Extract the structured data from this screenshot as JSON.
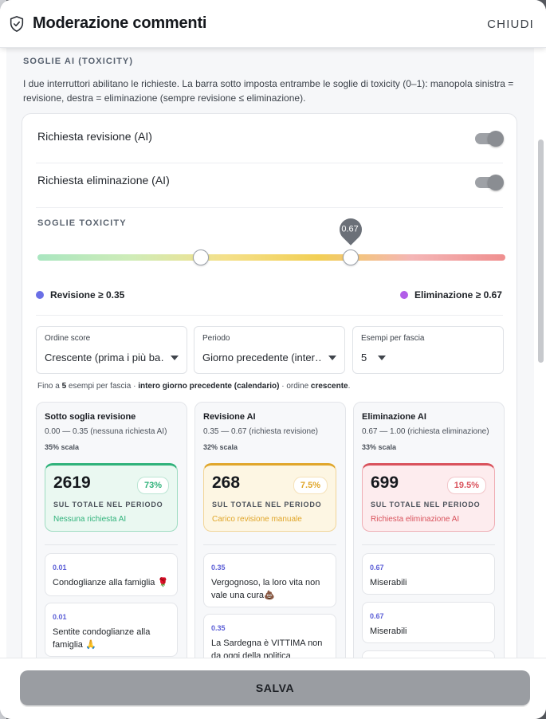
{
  "header": {
    "title": "Moderazione commenti",
    "close_label": "CHIUDI"
  },
  "section": {
    "title": "SOGLIE AI (TOXICITY)",
    "description": "I due interruttori abilitano le richieste. La barra sotto imposta entrambe le soglie di toxicity (0–1): manopola sinistra = revisione, destra = eliminazione (sempre revisione ≤ eliminazione)."
  },
  "toggles": [
    {
      "label": "Richiesta revisione (AI)",
      "on": true
    },
    {
      "label": "Richiesta eliminazione (AI)",
      "on": true
    }
  ],
  "slider": {
    "title": "SOGLIE TOXICITY",
    "review_threshold": 0.35,
    "delete_threshold": 0.67,
    "tooltip": "0.67",
    "legend_review": "Revisione ≥ 0.35",
    "legend_delete": "Eliminazione ≥ 0.67",
    "review_color": "#6a6fe6",
    "delete_color": "#b25ee8"
  },
  "selects": [
    {
      "label": "Ordine score",
      "value": "Crescente (prima i più ba…"
    },
    {
      "label": "Periodo",
      "value": "Giorno precedente (inter…"
    },
    {
      "label": "Esempi per fascia",
      "value": "5"
    }
  ],
  "summary": {
    "prefix": "Fino a ",
    "count": "5",
    "mid1": " esempi per fascia · ",
    "period": "intero giorno precedente (calendario)",
    "mid2": " · ordine ",
    "order": "crescente",
    "suffix": "."
  },
  "columns": [
    {
      "title": "Sotto soglia revisione",
      "range": "0.00 — 0.35 (nessuna richiesta AI)",
      "scale": "35% scala",
      "count": "2619",
      "pct": "73%",
      "subtitle": "SUL TOTALE NEL PERIODO",
      "note": "Nessuna richiesta AI",
      "accent": "#2fb27a",
      "examples": [
        {
          "score": "0.01",
          "text": "Condoglianze alla famiglia 🌹"
        },
        {
          "score": "0.01",
          "text": "Sentite condoglianze alla famiglia 🙏"
        }
      ]
    },
    {
      "title": "Revisione AI",
      "range": "0.35 — 0.67 (richiesta revisione)",
      "scale": "32% scala",
      "count": "268",
      "pct": "7.5%",
      "subtitle": "SUL TOTALE NEL PERIODO",
      "note": "Carico revisione manuale",
      "accent": "#e0a62a",
      "examples": [
        {
          "score": "0.35",
          "text": "Vergognoso, la loro vita non vale una cura💩"
        },
        {
          "score": "0.35",
          "text": "La Sardegna è VITTIMA non da oggi della politica"
        }
      ]
    },
    {
      "title": "Eliminazione AI",
      "range": "0.67 — 1.00 (richiesta eliminazione)",
      "scale": "33% scala",
      "count": "699",
      "pct": "19.5%",
      "subtitle": "SUL TOTALE NEL PERIODO",
      "note": "Richiesta eliminazione AI",
      "accent": "#d9525c",
      "examples": [
        {
          "score": "0.67",
          "text": "Miserabili"
        },
        {
          "score": "0.67",
          "text": "Miserabili"
        }
      ]
    }
  ],
  "footer": {
    "save_label": "SALVA"
  }
}
